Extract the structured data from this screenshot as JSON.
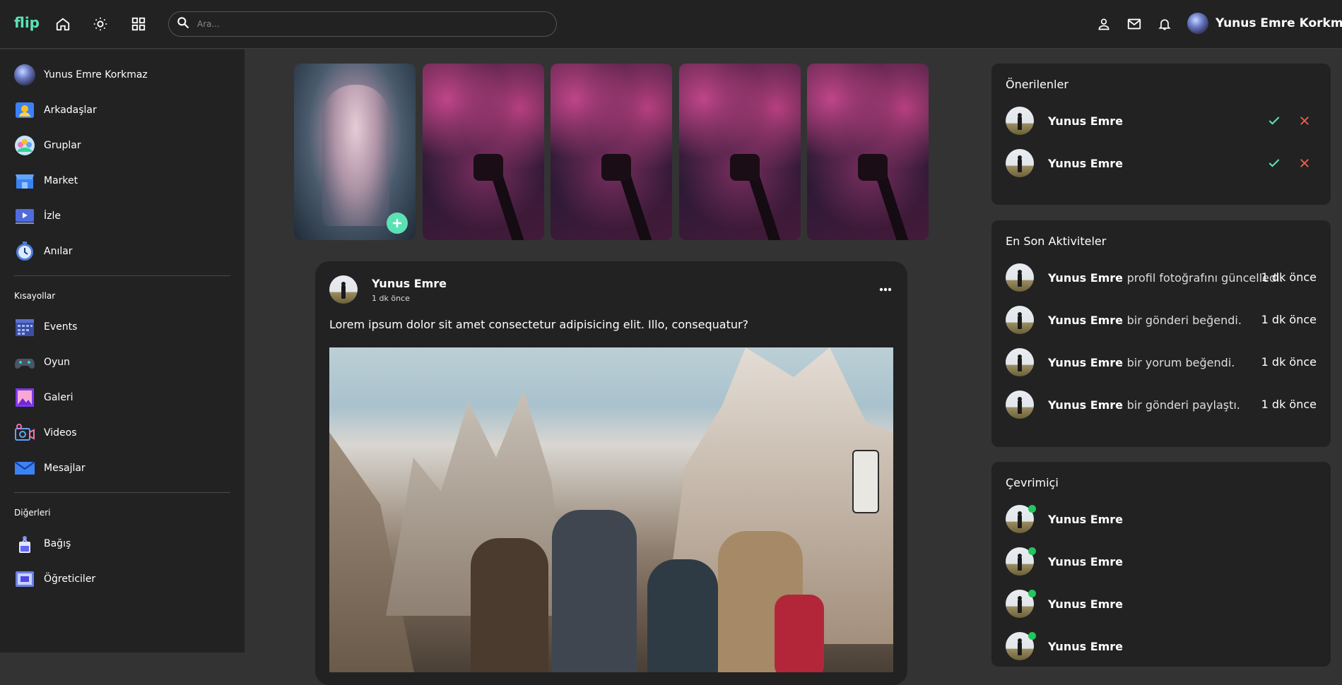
{
  "navbar": {
    "logo": "flip",
    "search_placeholder": "Ara...",
    "user_name": "Yunus Emre Korkmaz"
  },
  "sidebar": {
    "profile_name": "Yunus Emre Korkmaz",
    "items": [
      {
        "label": "Arkadaşlar",
        "icon": "friends-icon"
      },
      {
        "label": "Gruplar",
        "icon": "groups-icon"
      },
      {
        "label": "Market",
        "icon": "market-icon"
      },
      {
        "label": "İzle",
        "icon": "watch-icon"
      },
      {
        "label": "Anılar",
        "icon": "memories-icon"
      }
    ],
    "shortcuts_heading": "Kısayollar",
    "shortcuts": [
      {
        "label": "Events",
        "icon": "calendar-icon"
      },
      {
        "label": "Oyun",
        "icon": "gamepad-icon"
      },
      {
        "label": "Galeri",
        "icon": "gallery-icon"
      },
      {
        "label": "Videos",
        "icon": "video-icon"
      },
      {
        "label": "Mesajlar",
        "icon": "mail-icon"
      }
    ],
    "others_heading": "Diğerleri",
    "others": [
      {
        "label": "Bağış",
        "icon": "donation-icon"
      },
      {
        "label": "Öğreticiler",
        "icon": "tutorials-icon"
      }
    ]
  },
  "post": {
    "author": "Yunus Emre",
    "time": "1 dk önce",
    "text": "Lorem ipsum dolor sit amet consectetur adipisicing elit. Illo, consequatur?"
  },
  "suggestions": {
    "title": "Önerilenler",
    "items": [
      {
        "name": "Yunus Emre"
      },
      {
        "name": "Yunus Emre"
      }
    ]
  },
  "activities": {
    "title": "En Son Aktiviteler",
    "items": [
      {
        "name": "Yunus Emre",
        "action": "profil fotoğrafını güncelledi.",
        "time": "1 dk önce"
      },
      {
        "name": "Yunus Emre",
        "action": "bir gönderi beğendi.",
        "time": "1 dk önce"
      },
      {
        "name": "Yunus Emre",
        "action": "bir yorum beğendi.",
        "time": "1 dk önce"
      },
      {
        "name": "Yunus Emre",
        "action": "bir gönderi paylaştı.",
        "time": "1 dk önce"
      }
    ]
  },
  "online": {
    "title": "Çevrimiçi",
    "items": [
      {
        "name": "Yunus Emre"
      },
      {
        "name": "Yunus Emre"
      },
      {
        "name": "Yunus Emre"
      },
      {
        "name": "Yunus Emre"
      }
    ]
  },
  "colors": {
    "accent": "#5ce1b5",
    "accept": "#5ce1b5",
    "reject": "#f0604d",
    "online": "#22c55e",
    "panel_bg": "#222222",
    "page_bg": "#333333"
  }
}
